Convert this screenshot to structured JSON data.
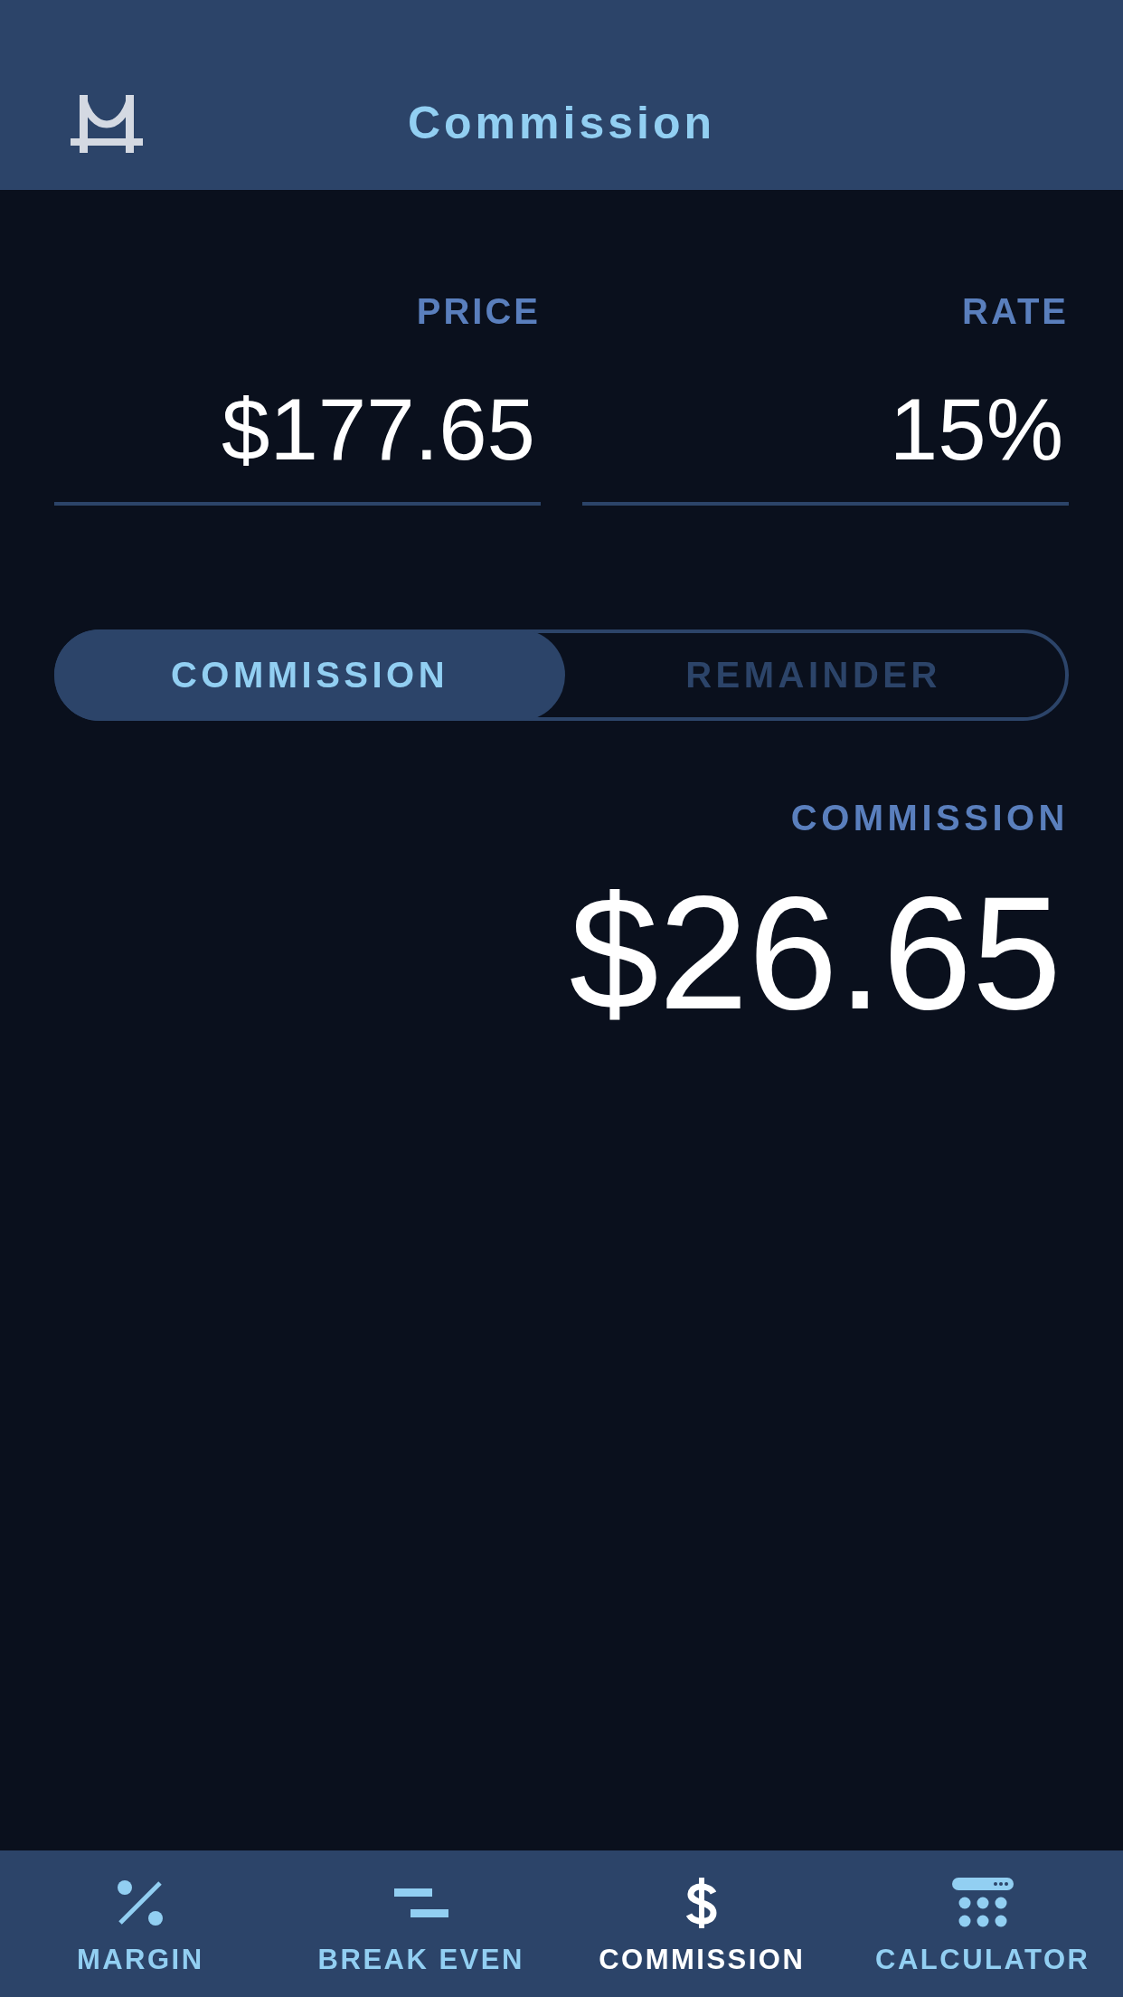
{
  "header": {
    "title": "Commission"
  },
  "inputs": [
    {
      "label": "PRICE",
      "value": "$177.65"
    },
    {
      "label": "RATE",
      "value": "15%"
    }
  ],
  "mode_toggle": [
    {
      "label": "COMMISSION",
      "selected": true
    },
    {
      "label": "REMAINDER",
      "selected": false
    }
  ],
  "result": {
    "label": "COMMISSION",
    "value": "$26.65"
  },
  "tab_bar": [
    {
      "label": "MARGIN",
      "kind": "percent",
      "selected": false
    },
    {
      "label": "BREAK EVEN",
      "kind": "bars",
      "selected": false
    },
    {
      "label": "COMMISSION",
      "kind": "dollar",
      "selected": true
    },
    {
      "label": "CALCULATOR",
      "kind": "calculator",
      "selected": false
    }
  ]
}
